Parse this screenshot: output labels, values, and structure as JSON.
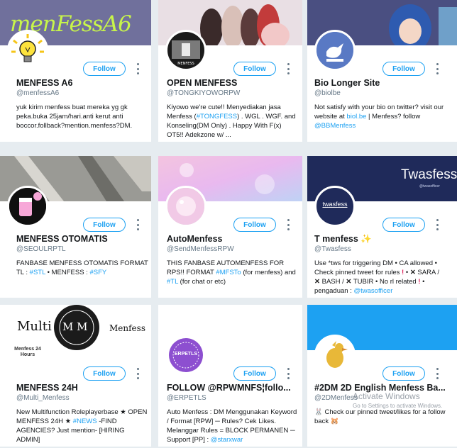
{
  "follow_label": "Follow",
  "colors": {
    "accent": "#1da1f2",
    "text": "#14171a",
    "muted": "#657786",
    "bg": "#e6ecf0"
  },
  "cards": [
    {
      "name": "MENFESS A6",
      "handle": "@menfessA6",
      "banner_text": "menFessA6",
      "bio": "yuk kirim menfess buat mereka yg gk peka.buka 25jam/hari.anti kerut anti boccor.follback?mention.menfess?DM."
    },
    {
      "name": "OPEN MENFESS",
      "handle": "@TONGKIYOWORPW",
      "bio_pre": "Kiyowo we're cute!! Menyediakan jasa Menfess (",
      "bio_link": "#TONGFESS",
      "bio_post": ") . WGL . WGF. and Konseling(DM Only) . Happy With F(x) OT5!! Adekzone w/ ..."
    },
    {
      "name": "Bio Longer Site",
      "handle": "@biolbe",
      "bio_pre": "Not satisfy with your bio on twitter? visit our website at ",
      "bio_link": "biol.be",
      "bio_mid": " | Menfess? follow ",
      "bio_link2": "@BBMenfess"
    },
    {
      "name": "MENFESS OTOMATIS",
      "handle": "@SEOULRPTL",
      "bio_pre": "FANBASE MENFESS OTOMATIS FORMAT TL : ",
      "bio_link": "#STL",
      "bio_mid": " • MENFESS : ",
      "bio_link2": "#SFY"
    },
    {
      "name": "AutoMenfess",
      "handle": "@SendMenfessRPW",
      "bio_pre": "THIS FANBASE AUTOMENFESS FOR RPS!! FORMAT ",
      "bio_link": "#MFSTo",
      "bio_mid": " (for menfess) and ",
      "bio_link2": "#TL",
      "bio_post": " (for chat or etc)"
    },
    {
      "name": "T menfess",
      "handle": "@Twasfess",
      "banner_text": "Twasfess",
      "banner_sub": "@twasofficer",
      "avatar_text": "twasfess",
      "bio_a": "Use *tws for triggering DM • CA allowed • Check pinned tweet for rules ",
      "bio_b": " SARA / ",
      "bio_c": " BASH / ",
      "bio_d": " TUBIR • No rl related ",
      "bio_e": " • pengaduan : ",
      "bio_link": "@twasofficer"
    },
    {
      "name": "MENFESS 24H",
      "handle": "@Multi_Menfess",
      "banner_left": "Multi",
      "banner_mid": "M M",
      "banner_right": "Menfess",
      "avatar_text": "Menfess 24 Hours",
      "bio_pre": "New Multifunction Roleplayerbase ★ OPEN MENFESS 24H ★ ",
      "bio_link": "#NEWS",
      "bio_post": " -FIND AGENCIES? Just mention- [HIRING ADMIN]"
    },
    {
      "name": "FOLLOW @RPWMNFS¦follo...",
      "handle": "@ERPETLS",
      "avatar_text": "ERPETLS",
      "bio_pre": "Auto Menfess : DM Menggunakan Keyword / Format [RPW] ─ Rules? Cek Likes. Melanggar Rules = BLOCK PERMANEN ─ Support [PP] : ",
      "bio_link": "@starxwar"
    },
    {
      "name": "#2DM 2D English Menfess Ba...",
      "handle": "@2DMenfess",
      "bio": "Check our pinned tweet/likes for a follow back"
    }
  ],
  "watermark": {
    "title": "Activate Windows",
    "subtitle": "Go to Settings to activate Windows."
  }
}
